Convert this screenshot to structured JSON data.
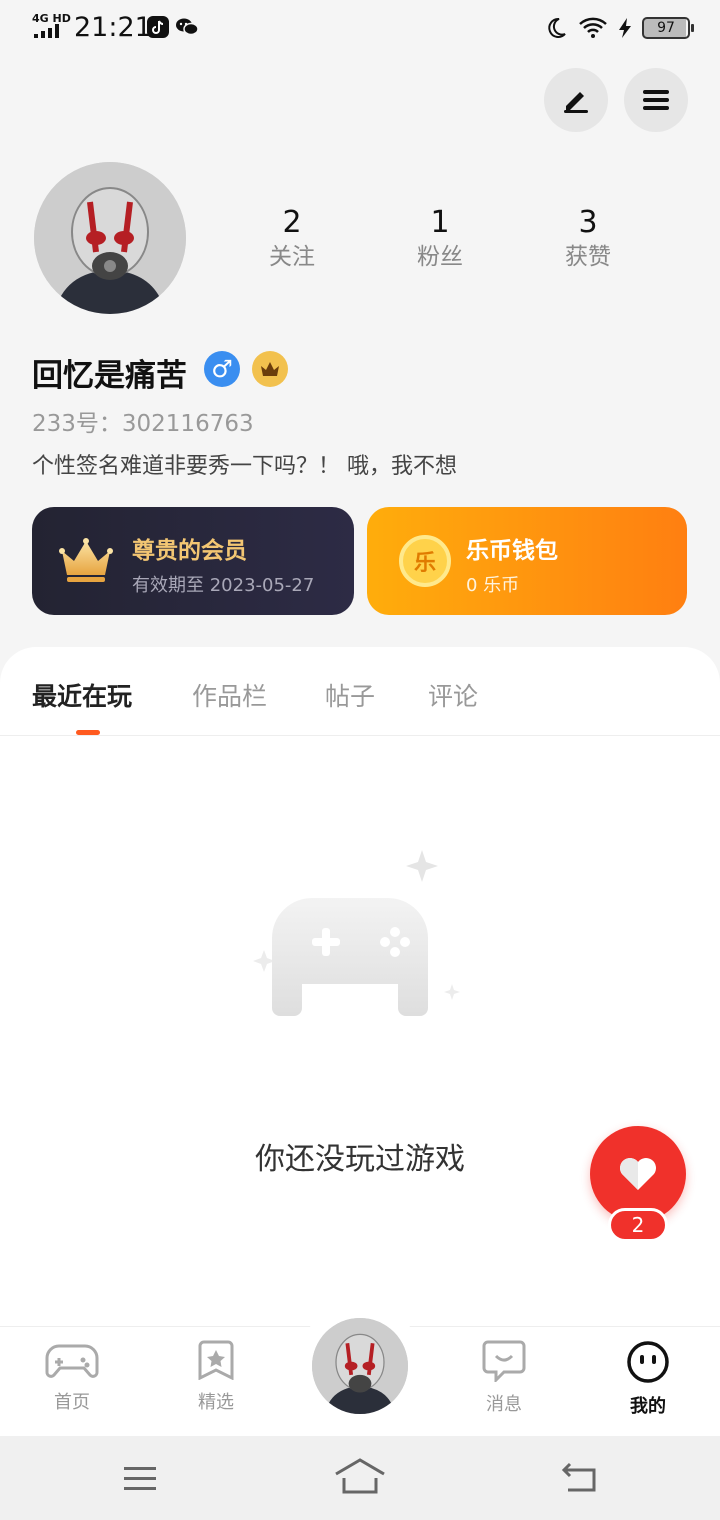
{
  "status_bar": {
    "network": "4G HD",
    "time": "21:21",
    "battery": "97",
    "left_icons": [
      "tiktok-icon",
      "wechat-icon"
    ],
    "right_icons": [
      "moon-icon",
      "wifi-icon",
      "charging-icon"
    ]
  },
  "header": {
    "actions": [
      "edit-icon",
      "menu-icon"
    ]
  },
  "profile": {
    "stats": [
      {
        "value": "2",
        "label": "关注"
      },
      {
        "value": "1",
        "label": "粉丝"
      },
      {
        "value": "3",
        "label": "获赞"
      }
    ],
    "name": "回忆是痛苦",
    "gender_symbol": "♂",
    "uid_text": "233号：302116763",
    "bio": "个性签名难道非要秀一下吗？！ 哦，我不想"
  },
  "cards": {
    "vip": {
      "title": "尊贵的会员",
      "subtitle": "有效期至 2023-05-27"
    },
    "wallet": {
      "title": "乐币钱包",
      "subtitle": "0 乐币",
      "coin_char": "乐"
    }
  },
  "tabs": [
    {
      "label": "最近在玩",
      "active": true
    },
    {
      "label": "作品栏",
      "active": false
    },
    {
      "label": "帖子",
      "active": false
    },
    {
      "label": "评论",
      "active": false
    }
  ],
  "empty_state": {
    "text": "你还没玩过游戏"
  },
  "floating_like": {
    "count": "2"
  },
  "bottom_nav": [
    {
      "label": "首页",
      "icon": "gamepad-icon",
      "active": false
    },
    {
      "label": "精选",
      "icon": "star-bookmark-icon",
      "active": false
    },
    {
      "label": "消息",
      "icon": "message-icon",
      "active": false
    },
    {
      "label": "我的",
      "icon": "face-icon",
      "active": true
    }
  ],
  "colors": {
    "accent": "#ff5a1f",
    "vip_bg": "#232332",
    "vip_text": "#f3c673",
    "wallet_bg": "#ff9a10",
    "like_red": "#f0312b"
  }
}
